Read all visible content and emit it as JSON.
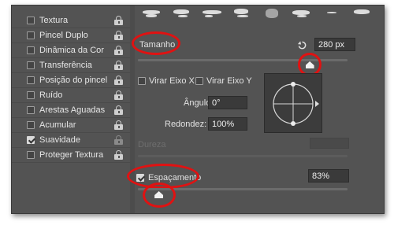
{
  "brush_options": {
    "items": [
      {
        "label": "Textura",
        "checked": false,
        "active": false
      },
      {
        "label": "Pincel Duplo",
        "checked": false,
        "active": false
      },
      {
        "label": "Dinâmica da Cor",
        "checked": false,
        "active": false
      },
      {
        "label": "Transferência",
        "checked": false,
        "active": false
      },
      {
        "label": "Posição do pincel",
        "checked": false,
        "active": false
      },
      {
        "label": "Ruído",
        "checked": false,
        "active": false
      },
      {
        "label": "Arestas Aguadas",
        "checked": false,
        "active": false
      },
      {
        "label": "Acumular",
        "checked": false,
        "active": false
      },
      {
        "label": "Suavidade",
        "checked": true,
        "active": true
      },
      {
        "label": "Proteger Textura",
        "checked": false,
        "active": false
      }
    ]
  },
  "brush_tip": {
    "size_label": "Tamanho",
    "size_value": "280 px",
    "size_fraction": 0.82,
    "flip_x_label": "Virar Eixo X",
    "flip_y_label": "Virar Eixo Y",
    "angle_label": "Ângulo:",
    "angle_value": "0°",
    "roundness_label": "Redondez:",
    "roundness_value": "100%",
    "hardness_label": "Dureza",
    "spacing_label": "Espaçamento",
    "spacing_checked": true,
    "spacing_value": "83%",
    "spacing_fraction": 0.1
  },
  "colors": {
    "panel": "#535353",
    "highlight": "#e01212"
  }
}
